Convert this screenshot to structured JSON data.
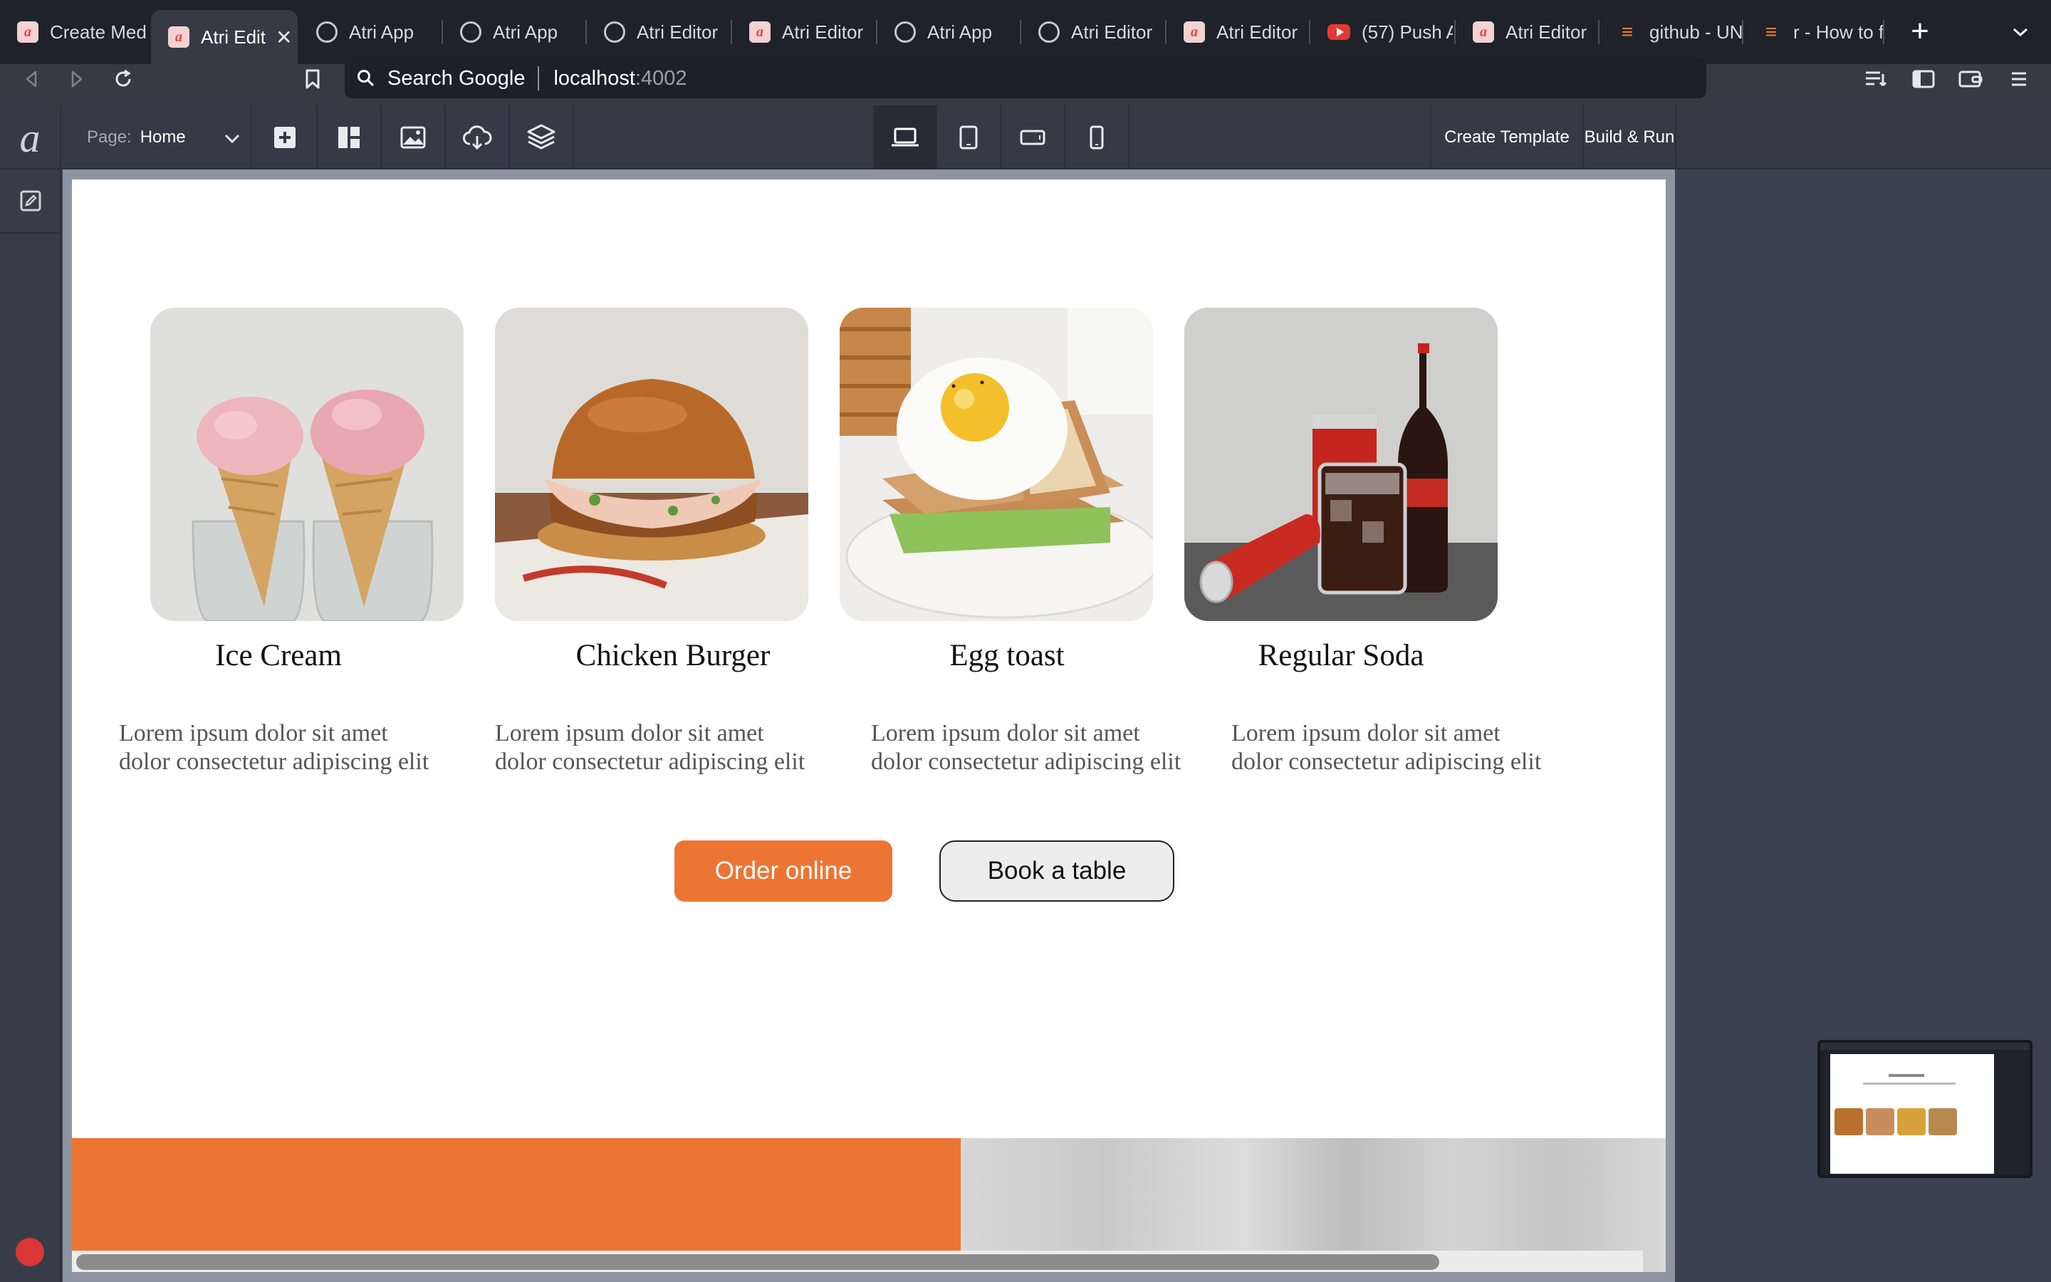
{
  "browser": {
    "tabs": [
      {
        "label": "Create Med",
        "icon": "atri-favicon"
      },
      {
        "label": "Atri Edit",
        "icon": "atri-favicon",
        "active": true
      },
      {
        "label": "Atri App",
        "icon": "globe-icon"
      },
      {
        "label": "Atri App",
        "icon": "globe-icon"
      },
      {
        "label": "Atri Editor",
        "icon": "globe-icon"
      },
      {
        "label": "Atri Editor",
        "icon": "atri-favicon"
      },
      {
        "label": "Atri App",
        "icon": "globe-icon"
      },
      {
        "label": "Atri Editor",
        "icon": "globe-icon"
      },
      {
        "label": "Atri Editor",
        "icon": "atri-favicon"
      },
      {
        "label": "(57) Push A",
        "icon": "youtube-icon"
      },
      {
        "label": "Atri Editor",
        "icon": "atri-favicon"
      },
      {
        "label": "github - UN",
        "icon": "stackoverflow-icon"
      },
      {
        "label": "r - How to f",
        "icon": "stackoverflow-icon"
      }
    ],
    "address": {
      "search_label": "Search Google",
      "host": "localhost",
      "port": ":4002"
    }
  },
  "editor": {
    "logo": "a",
    "page_select": {
      "prefix": "Page:",
      "value": "Home"
    },
    "create_template_label": "Create Template",
    "build_run_label": "Build & Run"
  },
  "menu": {
    "items": [
      {
        "title": "Ice Cream",
        "desc_line1": "Lorem ipsum dolor sit amet",
        "desc_line2": "dolor consectetur adipiscing elit"
      },
      {
        "title": "Chicken Burger",
        "desc_line1": "Lorem ipsum dolor sit amet",
        "desc_line2": "dolor consectetur adipiscing elit"
      },
      {
        "title": "Egg toast",
        "desc_line1": "Lorem ipsum dolor sit amet",
        "desc_line2": "dolor consectetur adipiscing elit"
      },
      {
        "title": "Regular Soda",
        "desc_line1": "Lorem ipsum dolor sit amet",
        "desc_line2": "dolor consectetur adipiscing elit"
      }
    ],
    "order_label": "Order online",
    "book_label": "Book a table"
  },
  "colors": {
    "accent_orange": "#ec7534",
    "browser_chrome": "#1f2229",
    "editor_toolbar": "#343b47",
    "canvas_bg": "#ffffff"
  }
}
